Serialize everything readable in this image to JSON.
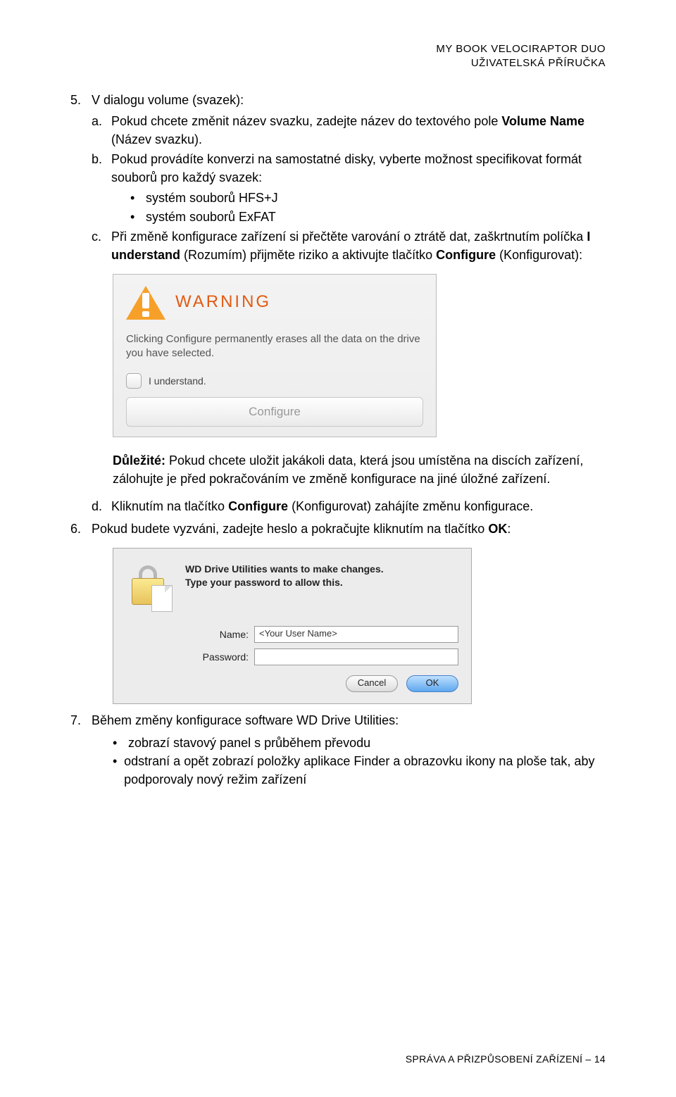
{
  "header": {
    "line1": "MY BOOK VELOCIRAPTOR DUO",
    "line2": "UŽIVATELSKÁ PŘÍRUČKA"
  },
  "step5": {
    "num": "5.",
    "intro": "V dialogu volume (svazek):",
    "a": {
      "let": "a.",
      "text_before": "Pokud chcete změnit název svazku, zadejte název do textového pole ",
      "bold": "Volume Name",
      "text_after": " (Název svazku)."
    },
    "b": {
      "let": "b.",
      "text": "Pokud provádíte konverzi na samostatné disky, vyberte možnost specifikovat formát souborů pro každý svazek:",
      "bullets": [
        "systém souborů HFS+J",
        "systém souborů ExFAT"
      ]
    },
    "c": {
      "let": "c.",
      "t1": "Při změně konfigurace zařízení si přečtěte varování o ztrátě dat, zaškrtnutím políčka ",
      "b1": "I understand",
      "t2": " (Rozumím) přijměte riziko a aktivujte tlačítko ",
      "b2": "Configure",
      "t3": " (Konfigurovat):"
    }
  },
  "warning_dialog": {
    "title": "WARNING",
    "text": "Clicking Configure permanently erases all the data on the drive you have selected.",
    "checkbox_label": "I understand.",
    "button": "Configure"
  },
  "important": {
    "label": "Důležité:",
    "text": " Pokud chcete uložit jakákoli data, která jsou umístěna na discích zařízení, zálohujte je před pokračováním ve změně konfigurace na jiné úložné zařízení."
  },
  "step5d": {
    "let": "d.",
    "t1": "Kliknutím na tlačítko ",
    "b1": "Configure",
    "t2": " (Konfigurovat) zahájíte změnu konfigurace."
  },
  "step6": {
    "num": "6.",
    "t1": "Pokud budete vyzváni, zadejte heslo a pokračujte kliknutím na tlačítko ",
    "b1": "OK",
    "t2": ":"
  },
  "auth_dialog": {
    "msg1": "WD Drive Utilities wants to make changes.",
    "msg2": "Type your password to allow this.",
    "name_label": "Name:",
    "name_value": "<Your User Name>",
    "password_label": "Password:",
    "password_value": "",
    "cancel": "Cancel",
    "ok": "OK"
  },
  "step7": {
    "num": "7.",
    "text": "Během změny konfigurace software WD Drive Utilities:",
    "bullets": [
      "zobrazí stavový panel s průběhem převodu",
      "odstraní a opět zobrazí položky aplikace Finder a obrazovku ikony na ploše tak, aby podporovaly nový režim zařízení"
    ]
  },
  "footer": "SPRÁVA A PŘIZPŮSOBENÍ ZAŘÍZENÍ – 14"
}
